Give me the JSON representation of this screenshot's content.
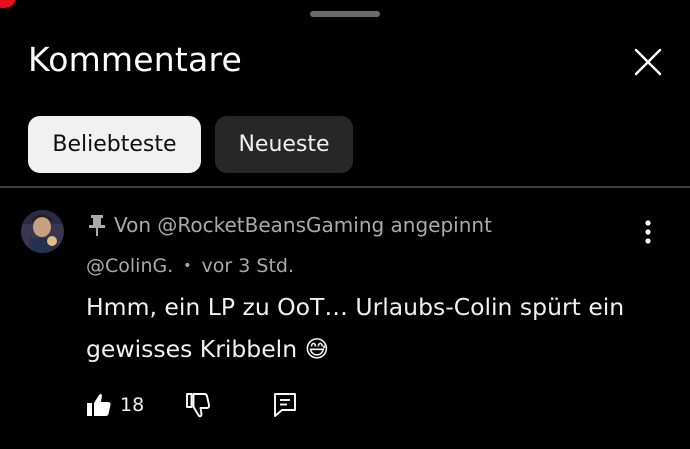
{
  "sheet": {
    "title": "Kommentare",
    "close_icon": "close-icon",
    "sort_chips": [
      {
        "label": "Beliebteste",
        "selected": true
      },
      {
        "label": "Neueste",
        "selected": false
      }
    ]
  },
  "comment": {
    "pinned_text": "Von @RocketBeansGaming angepinnt",
    "author": "@ColinG.",
    "separator": "•",
    "timestamp": "vor 3 Std.",
    "text": "Hmm, ein LP zu OoT… Urlaubs-Colin spürt ein gewisses Kribbeln 😅",
    "like_count": "18",
    "icons": {
      "pin": "pin-icon",
      "more": "more-vertical-icon",
      "like": "thumbs-up-filled-icon",
      "dislike": "thumbs-down-icon",
      "reply": "comment-reply-icon"
    }
  },
  "colors": {
    "background": "#000000",
    "chip_active_bg": "#f1f1f1",
    "chip_inactive_bg": "#272727",
    "secondary_text": "#aaaaaa",
    "divider": "#3f3f3f"
  }
}
